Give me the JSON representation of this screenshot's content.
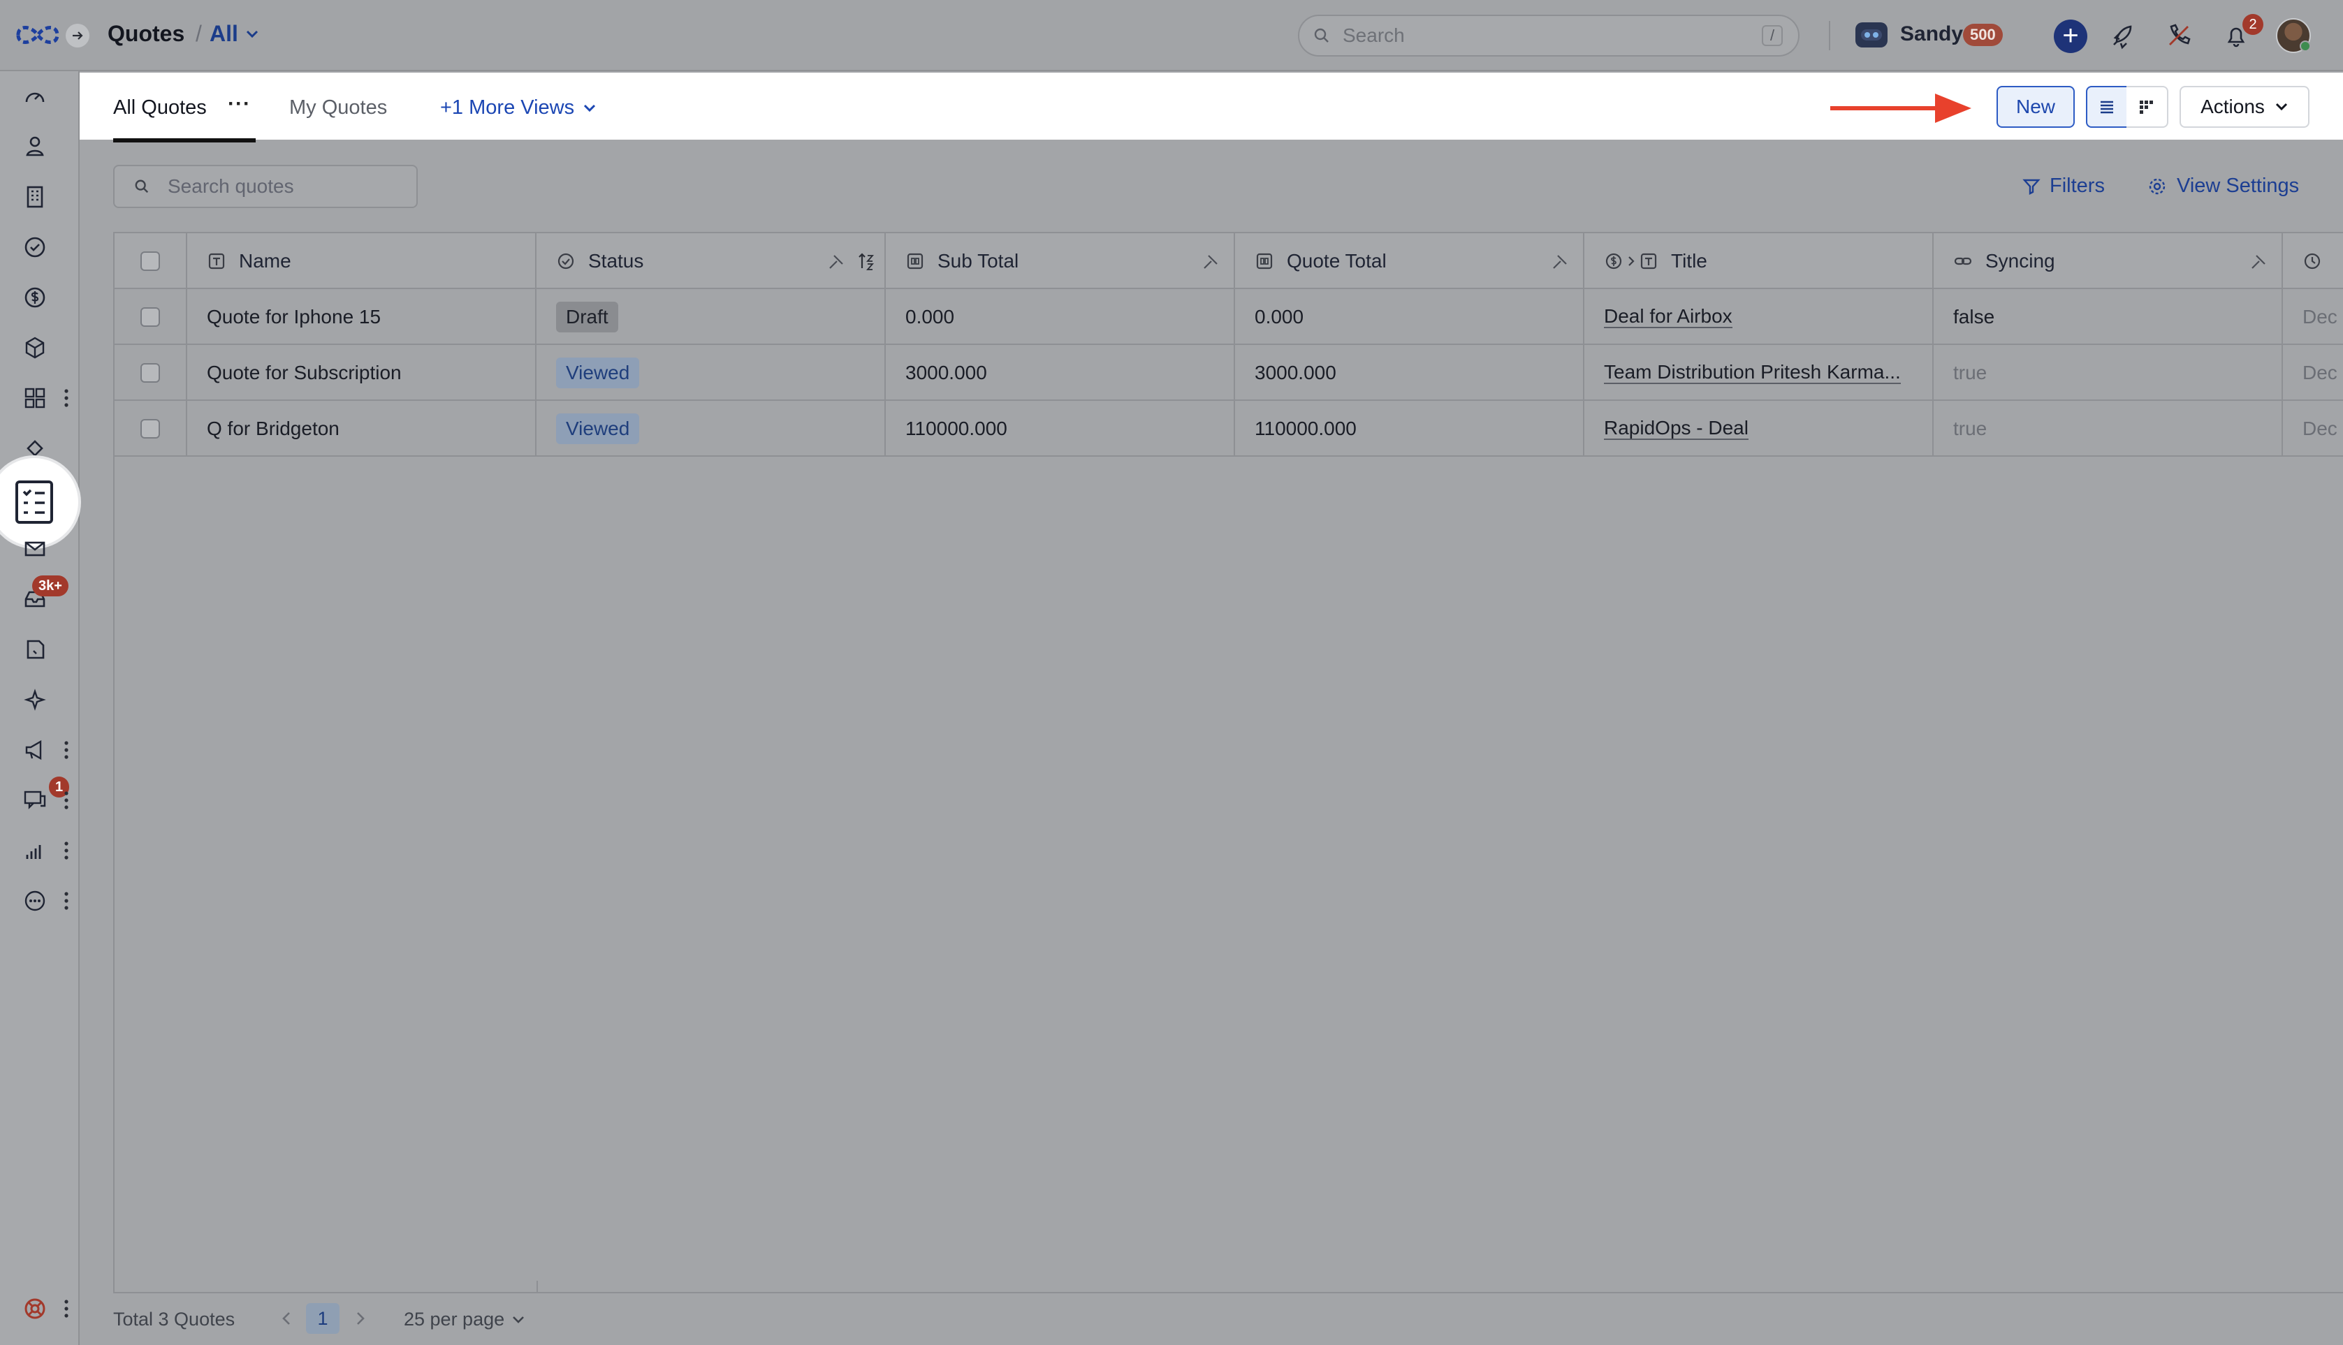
{
  "header": {
    "title": "Quotes",
    "separator": "/",
    "view_switch": "All",
    "search_placeholder": "Search",
    "search_shortcut": "/",
    "user_name": "Sandy",
    "credits": "500",
    "notifications_count": "2"
  },
  "sidebar": {
    "badges": {
      "inbox": "3k+",
      "conversations": "1"
    }
  },
  "views": {
    "tabs": [
      {
        "label": "All Quotes",
        "active": true
      },
      {
        "label": "My Quotes",
        "active": false
      }
    ],
    "more_dots": "···",
    "more_views": "+1 More Views"
  },
  "toolbar": {
    "new_label": "New",
    "actions_label": "Actions",
    "search_placeholder": "Search quotes",
    "filters_label": "Filters",
    "view_settings_label": "View Settings"
  },
  "table": {
    "columns": [
      "Name",
      "Status",
      "Sub Total",
      "Quote Total",
      "Title",
      "Syncing"
    ],
    "rows": [
      {
        "name": "Quote for Iphone 15",
        "status": "Draft",
        "sub_total": "0.000",
        "quote_total": "0.000",
        "title": "Deal for Airbox",
        "syncing": "false",
        "next": "Dec"
      },
      {
        "name": "Quote for Subscription",
        "status": "Viewed",
        "sub_total": "3000.000",
        "quote_total": "3000.000",
        "title": "Team Distribution Pritesh Karma...",
        "syncing": "true",
        "next": "Dec"
      },
      {
        "name": "Q for Bridgeton",
        "status": "Viewed",
        "sub_total": "110000.000",
        "quote_total": "110000.000",
        "title": "RapidOps - Deal",
        "syncing": "true",
        "next": "Dec"
      }
    ]
  },
  "footer": {
    "total_label": "Total 3 Quotes",
    "current_page": "1",
    "per_page": "25 per page"
  },
  "colors": {
    "accent": "#2d5bc4",
    "annotation_arrow": "#e8412c",
    "badge": "#a2392b"
  }
}
